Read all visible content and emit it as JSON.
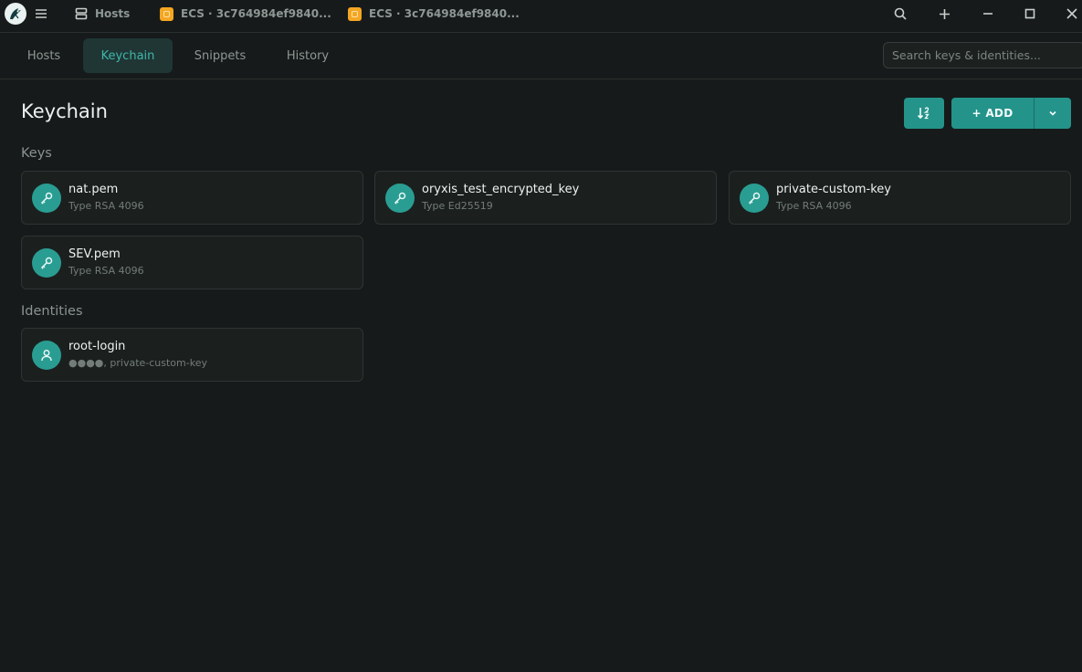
{
  "titlebar": {
    "tabs": [
      {
        "label": "Hosts"
      },
      {
        "label": "ECS · 3c764984ef9840..."
      },
      {
        "label": "ECS · 3c764984ef9840..."
      }
    ]
  },
  "nav": {
    "tabs": [
      {
        "label": "Hosts"
      },
      {
        "label": "Keychain",
        "active": true
      },
      {
        "label": "Snippets"
      },
      {
        "label": "History"
      }
    ],
    "search": {
      "placeholder": "Search keys & identities...",
      "value": ""
    }
  },
  "main": {
    "title": "Keychain",
    "add_label": "+ ADD",
    "sections": {
      "keys": {
        "label": "Keys",
        "items": [
          {
            "name": "nat.pem",
            "sub": "Type RSA 4096"
          },
          {
            "name": "oryxis_test_encrypted_key",
            "sub": "Type Ed25519"
          },
          {
            "name": "private-custom-key",
            "sub": "Type RSA 4096"
          },
          {
            "name": "SEV.pem",
            "sub": "Type RSA 4096"
          }
        ]
      },
      "identities": {
        "label": "Identities",
        "items": [
          {
            "name": "root-login",
            "sub": "●●●●, private-custom-key"
          }
        ]
      }
    }
  },
  "icons": [
    "app-logo-icon",
    "menu-icon",
    "server-icon",
    "ecs-icon",
    "search-icon",
    "plus-icon",
    "minimize-icon",
    "maximize-icon",
    "close-icon",
    "sort-icon",
    "chevron-down-icon",
    "key-icon",
    "user-icon"
  ],
  "colors": {
    "accent": "#24938a",
    "active_tab_text": "#3fb6aa",
    "background": "#161a1a",
    "tab_favicon": "#f5a623"
  }
}
